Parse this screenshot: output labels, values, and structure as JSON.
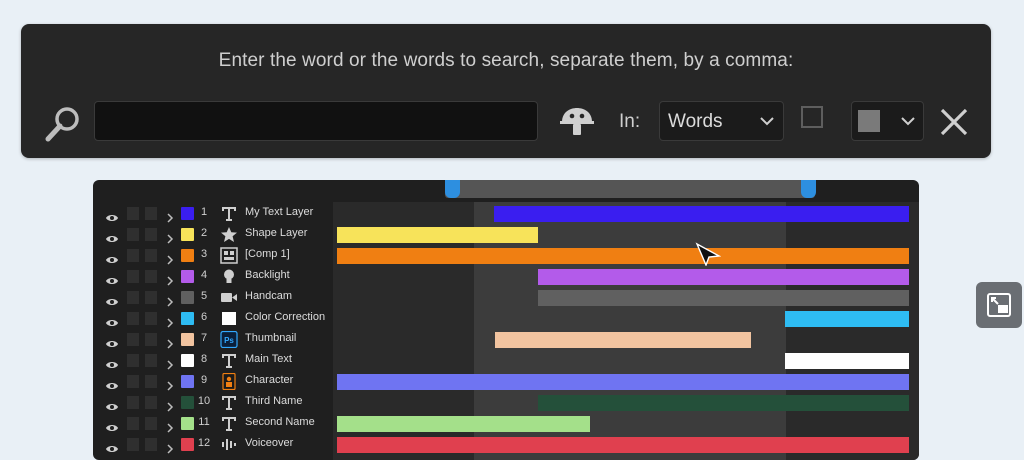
{
  "search": {
    "prompt": "Enter the word or the words to search, separate them, by a comma:",
    "query": "",
    "in_label": "In:",
    "scope": "Words",
    "case_checkbox_checked": false,
    "color_value": "#7a7a7a"
  },
  "timeline": {
    "layers": [
      {
        "index": "1",
        "name": "My Text Layer",
        "label_color": "#3a1ef0",
        "type_icon": "text-icon",
        "clip": {
          "start": 0.275,
          "end": 1.0,
          "color": "#3a1ef0"
        }
      },
      {
        "index": "2",
        "name": "Shape Layer",
        "label_color": "#f7e35a",
        "type_icon": "star-icon",
        "clip": {
          "start": 0.0,
          "end": 0.352,
          "color": "#f7e35a"
        }
      },
      {
        "index": "3",
        "name": "[Comp 1]",
        "label_color": "#f07f12",
        "type_icon": "comp-icon",
        "clip": {
          "start": 0.0,
          "end": 1.0,
          "color": "#f07f12"
        }
      },
      {
        "index": "4",
        "name": "Backlight",
        "label_color": "#b35bea",
        "type_icon": "bulb-icon",
        "clip": {
          "start": 0.352,
          "end": 1.0,
          "color": "#b35bea"
        }
      },
      {
        "index": "5",
        "name": "Handcam",
        "label_color": "#606060",
        "type_icon": "camera-icon",
        "clip": {
          "start": 0.352,
          "end": 1.0,
          "color": "#606060"
        }
      },
      {
        "index": "6",
        "name": "Color Correction",
        "label_color": "#2ebcf3",
        "type_icon": "solid-icon",
        "clip": {
          "start": 0.783,
          "end": 1.0,
          "color": "#2ebcf3"
        }
      },
      {
        "index": "7",
        "name": "Thumbnail",
        "label_color": "#f2c4a0",
        "type_icon": "photoshop-icon",
        "clip": {
          "start": 0.276,
          "end": 0.724,
          "color": "#f2c4a0"
        }
      },
      {
        "index": "8",
        "name": "Main Text",
        "label_color": "#ffffff",
        "type_icon": "text-icon",
        "clip": {
          "start": 0.783,
          "end": 1.0,
          "color": "#ffffff"
        }
      },
      {
        "index": "9",
        "name": "Character",
        "label_color": "#6f74f2",
        "type_icon": "character-icon",
        "clip": {
          "start": 0.0,
          "end": 1.0,
          "color": "#6f74f2"
        }
      },
      {
        "index": "10",
        "name": "Third Name",
        "label_color": "#24503a",
        "type_icon": "text-icon",
        "clip": {
          "start": 0.352,
          "end": 1.0,
          "color": "#24503a"
        }
      },
      {
        "index": "11",
        "name": "Second Name",
        "label_color": "#a4e08a",
        "type_icon": "text-icon",
        "clip": {
          "start": 0.0,
          "end": 0.442,
          "color": "#a4e08a"
        }
      },
      {
        "index": "12",
        "name": "Voiceover",
        "label_color": "#e0404f",
        "type_icon": "audio-icon",
        "clip": {
          "start": 0.0,
          "end": 1.0,
          "color": "#e0404f"
        }
      }
    ]
  }
}
